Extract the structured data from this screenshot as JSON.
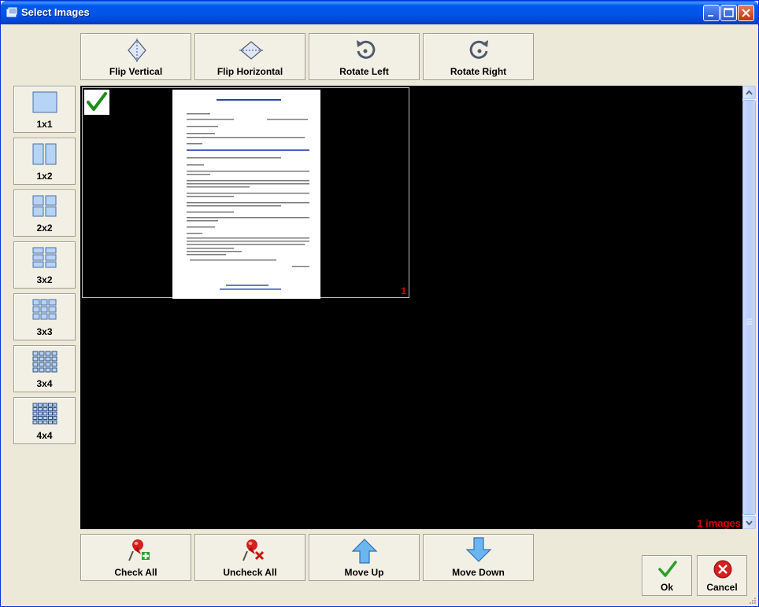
{
  "window": {
    "title": "Select Images"
  },
  "toolbar": {
    "flip_vertical": "Flip Vertical",
    "flip_horizontal": "Flip Horizontal",
    "rotate_left": "Rotate Left",
    "rotate_right": "Rotate Right"
  },
  "layouts": [
    "1x1",
    "1x2",
    "2x2",
    "3x2",
    "3x3",
    "3x4",
    "4x4"
  ],
  "viewer": {
    "page_number": "1",
    "image_count": "1 images",
    "thumbnail_checked": true
  },
  "actions": {
    "check_all": "Check All",
    "uncheck_all": "Uncheck All",
    "move_up": "Move Up",
    "move_down": "Move Down"
  },
  "dialog": {
    "ok": "Ok",
    "cancel": "Cancel"
  },
  "colors": {
    "accent_red": "#e00000",
    "viewer_bg": "#000000",
    "check_green": "#1a8f1a"
  }
}
